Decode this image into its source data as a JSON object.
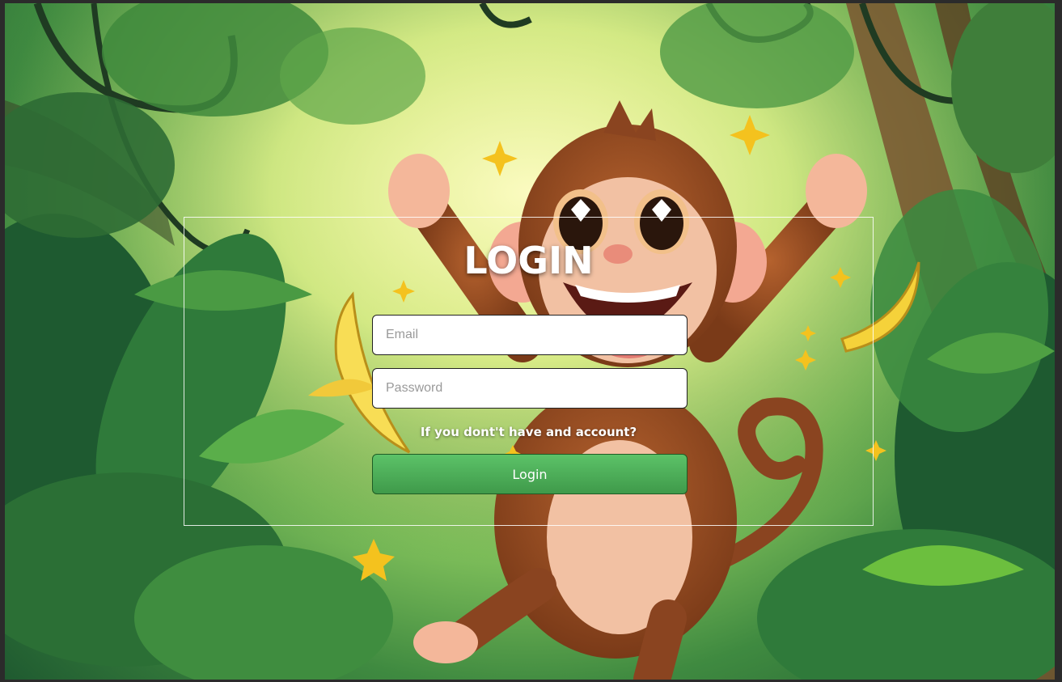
{
  "login": {
    "title": "LOGIN",
    "email_placeholder": "Email",
    "password_placeholder": "Password",
    "signup_prompt": "If you dont't have and account?",
    "button_label": "Login"
  },
  "colors": {
    "button_green": "#4caf50",
    "text_white": "#ffffff"
  },
  "background": {
    "scene": "jungle-monkey-illustration"
  }
}
